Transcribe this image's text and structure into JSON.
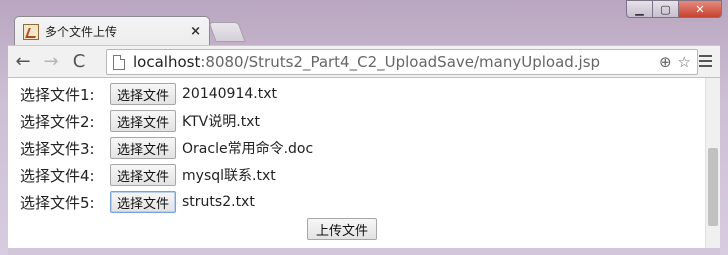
{
  "window": {
    "tab_title": "多个文件上传",
    "close_tab": "×",
    "minimize": "▁",
    "maximize": "▢",
    "close": "✕"
  },
  "toolbar": {
    "back": "←",
    "forward": "→",
    "reload": "C",
    "url_host": "localhost",
    "url_path": ":8080/Struts2_Part4_C2_UploadSave/manyUpload.jsp",
    "zoom_icon": "⊕",
    "star_icon": "☆"
  },
  "form": {
    "rows": [
      {
        "label": "选择文件1:",
        "button": "选择文件",
        "file": "20140914.txt"
      },
      {
        "label": "选择文件2:",
        "button": "选择文件",
        "file": "KTV说明.txt"
      },
      {
        "label": "选择文件3:",
        "button": "选择文件",
        "file": "Oracle常用命令.doc"
      },
      {
        "label": "选择文件4:",
        "button": "选择文件",
        "file": "mysql联系.txt"
      },
      {
        "label": "选择文件5:",
        "button": "选择文件",
        "file": "struts2.txt"
      }
    ],
    "submit_label": "上传文件"
  }
}
